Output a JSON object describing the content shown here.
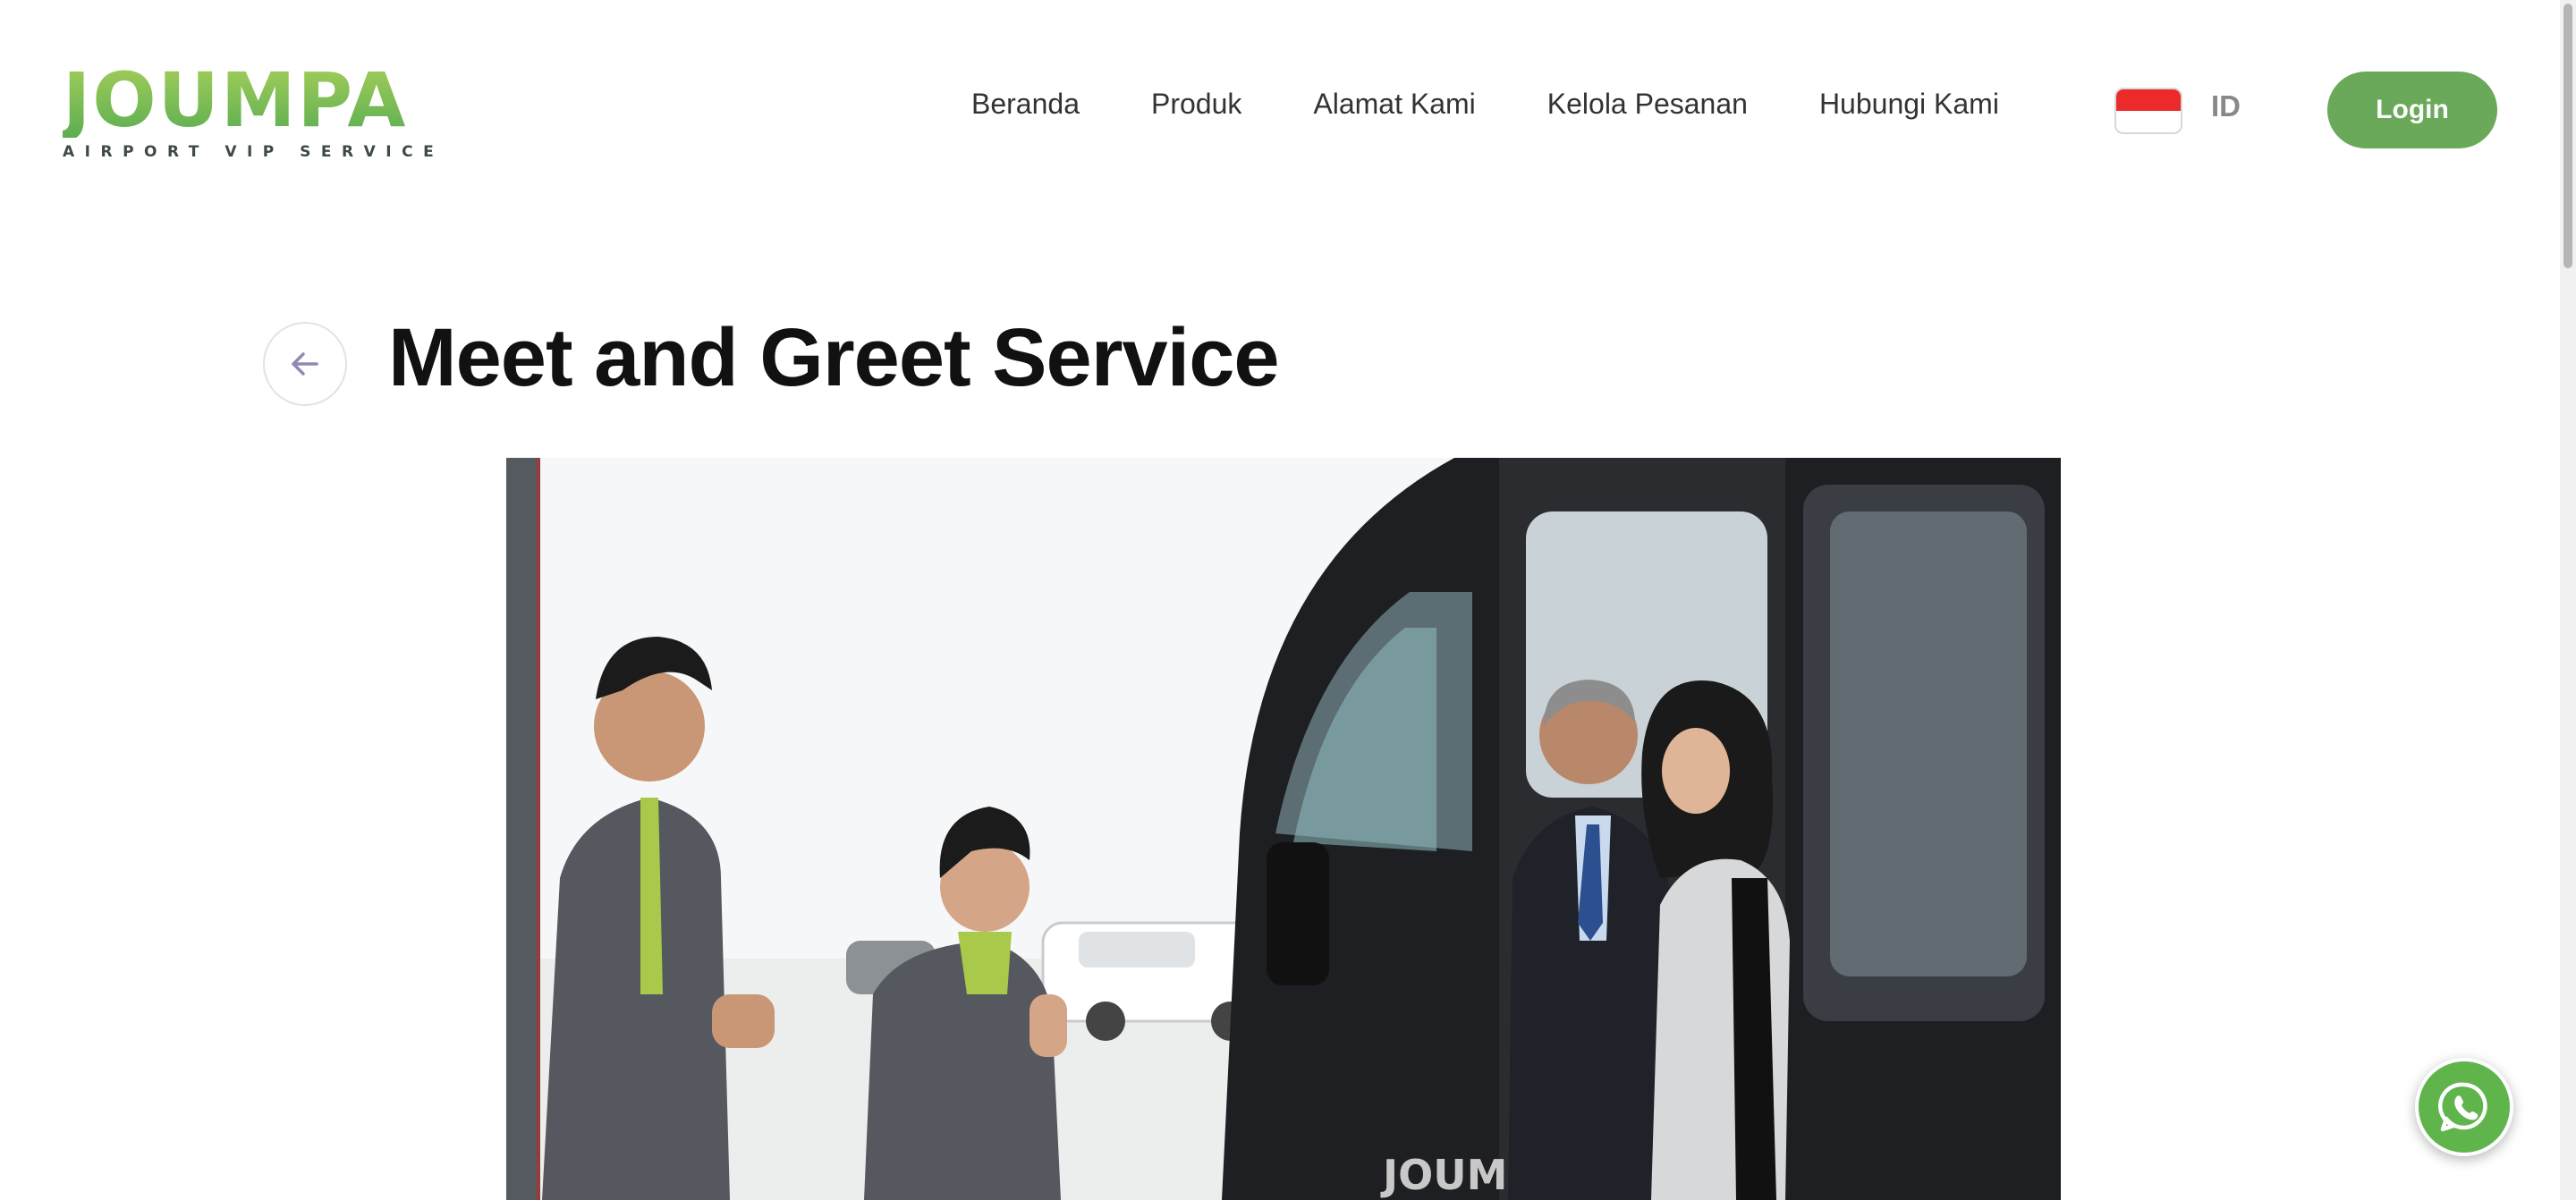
{
  "header": {
    "logo_word": "JOUMPA",
    "logo_sub": "AIRPORT VIP SERVICE",
    "nav": [
      {
        "label": "Beranda"
      },
      {
        "label": "Produk"
      },
      {
        "label": "Alamat Kami"
      },
      {
        "label": "Kelola Pesanan"
      },
      {
        "label": "Hubungi Kami"
      }
    ],
    "language": "ID",
    "login_label": "Login"
  },
  "main": {
    "title": "Meet and Greet Service",
    "hero_van_lettering": "JOUMPA"
  },
  "icons": {
    "back": "arrow-left-icon",
    "flag": "indonesia-flag-icon",
    "whatsapp": "whatsapp-icon"
  },
  "colors": {
    "brand_green": "#6aa85a",
    "logo_green_light": "#a3cd59",
    "logo_green_dark": "#5cae52",
    "flag_red": "#ec2a2a",
    "whatsapp_green": "#5fb44c"
  }
}
